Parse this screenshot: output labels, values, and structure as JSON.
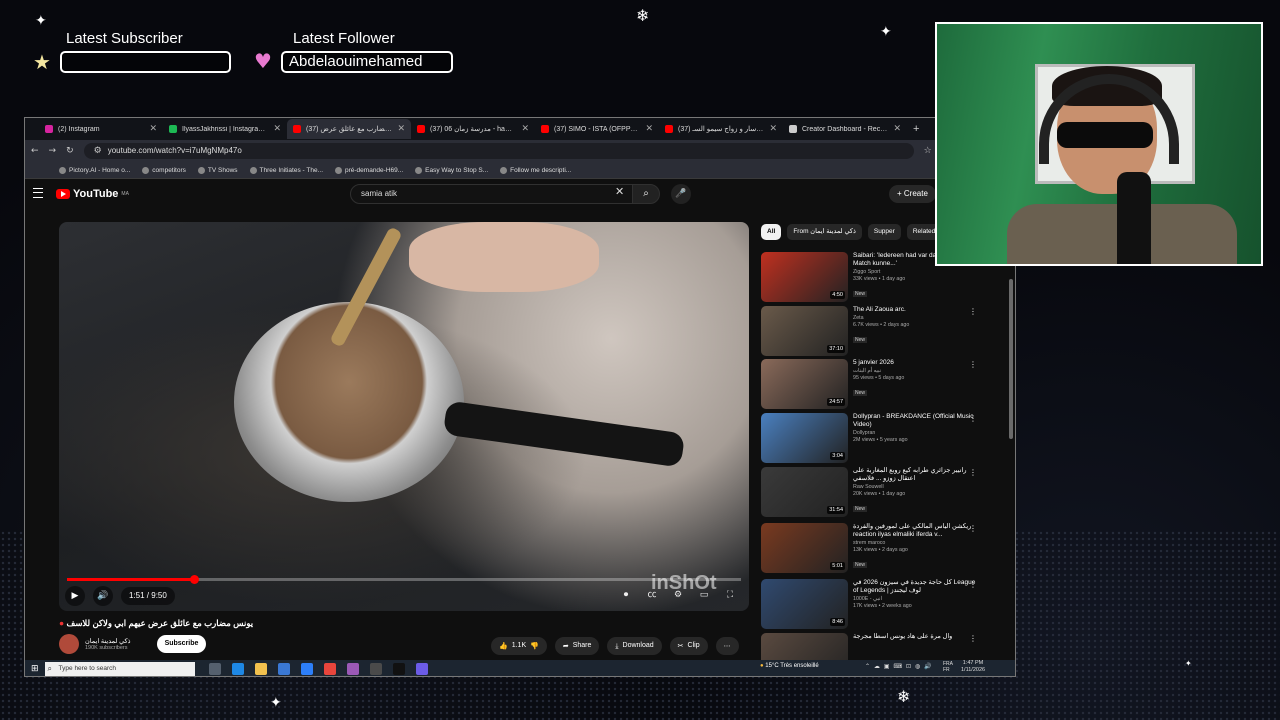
{
  "overlay": {
    "subscriber_label": "Latest Subscriber",
    "subscriber_value": "",
    "follower_label": "Latest Follower",
    "follower_value": "Abdelaouimehamed"
  },
  "browser": {
    "tabs": [
      {
        "label": "(2) Instagram",
        "color": "#d6249f",
        "active": false
      },
      {
        "label": "IlyassJakhrissi | Instagram, Face",
        "color": "#1db954",
        "active": false
      },
      {
        "label": "(37) يونس مضارب مع عائلق عرض",
        "color": "#ff0000",
        "active": true
      },
      {
        "label": "(37) مدرسة زمان 06 - hamawda",
        "color": "#ff0000",
        "active": false
      },
      {
        "label": "(37) SIMO - ISTA (OFPPT) - بنتي",
        "color": "#ff0000",
        "active": false
      },
      {
        "label": "(37) الشيخ سار و زواج سيمو السـ",
        "color": "#ff0000",
        "active": false
      },
      {
        "label": "Creator Dashboard - Recherch",
        "color": "#cccccc",
        "active": false
      }
    ],
    "url": "youtube.com/watch?v=i7uMgNMp47o",
    "bookmarks": [
      "Pictory.AI - Home o...",
      "competitors",
      "TV Shows",
      "Three Initiates - The...",
      "pré-demande-H69...",
      "Easy Way to Stop S...",
      "Follow me descripti..."
    ]
  },
  "youtube": {
    "logo": "YouTube",
    "region": "MA",
    "search_value": "samia atik",
    "create_label": "Create",
    "time": "1:51 / 9:50",
    "progress": 0.188,
    "watermark": "inShOt",
    "video_title": "يونس مضارب مع عائلق عرض عيهم ابي ولاكن للاسف",
    "channel": "ذكي لمدينة ايمان",
    "subscribers": "190K subscribers",
    "subscribe_label": "Subscribe",
    "likes": "1.1K",
    "share_label": "Share",
    "download_label": "Download",
    "clip_label": "Clip",
    "chips": [
      "All",
      "From ذكي لمدينة ايمان",
      "Supper",
      "Related"
    ],
    "recommendations": [
      {
        "title": "Saibari: 'Iedereen had var dat Man of the Match kunne...'",
        "channel": "Ziggo Sport",
        "views": "33K views • 1 day ago",
        "badge": "New",
        "duration": "4:50",
        "color": "#c03020"
      },
      {
        "title": "The Ali Zaoua arc.",
        "channel": "Zeta",
        "views": "6.7K views • 2 days ago",
        "badge": "New",
        "duration": "37:10",
        "color": "#6a5a4a"
      },
      {
        "title": "5 janvier 2026",
        "channel": "نبيه أم البنات",
        "views": "95 views • 5 days ago",
        "badge": "New",
        "duration": "24:57",
        "color": "#8a6a5a"
      },
      {
        "title": "Dollypran - BREAKDANCE (Official Music Video)",
        "channel": "Dollypran",
        "views": "2M views • 5 years ago",
        "badge": "",
        "duration": "3:04",
        "color": "#4a80c0"
      },
      {
        "title": "رانيير جزائري طرابه كيع روبع المغاربة على اعتقال زوزو ... فلاسفي",
        "channel": "Raw Souwell",
        "views": "20K views • 1 day ago",
        "badge": "New",
        "duration": "31:54",
        "color": "#3a3a3a"
      },
      {
        "title": "ريكشن الياس المالكي على لمورفين والفردة reaction ilyas elmaliki iferda v...",
        "channel": "strem maroco",
        "views": "13K views • 2 days ago",
        "badge": "New",
        "duration": "5:01",
        "color": "#7a3a20"
      },
      {
        "title": "كل حاجة جديدة في سيزون 2026 في League of Legends | لوف ليجندز",
        "channel": "1000E - انبي",
        "views": "17K views • 2 weeks ago",
        "badge": "",
        "duration": "8:46",
        "color": "#304a70"
      },
      {
        "title": "وال مرة على هاد يونس اسطا مجرجة",
        "channel": "",
        "views": "",
        "badge": "",
        "duration": "",
        "color": "#5a4a40"
      }
    ]
  },
  "taskbar": {
    "search_placeholder": "Type here to search",
    "weather": "15°C  Très ensoleillé",
    "lang": "FRA",
    "lang_sub": "FR",
    "time": "1:47 PM",
    "date": "1/11/2026"
  }
}
